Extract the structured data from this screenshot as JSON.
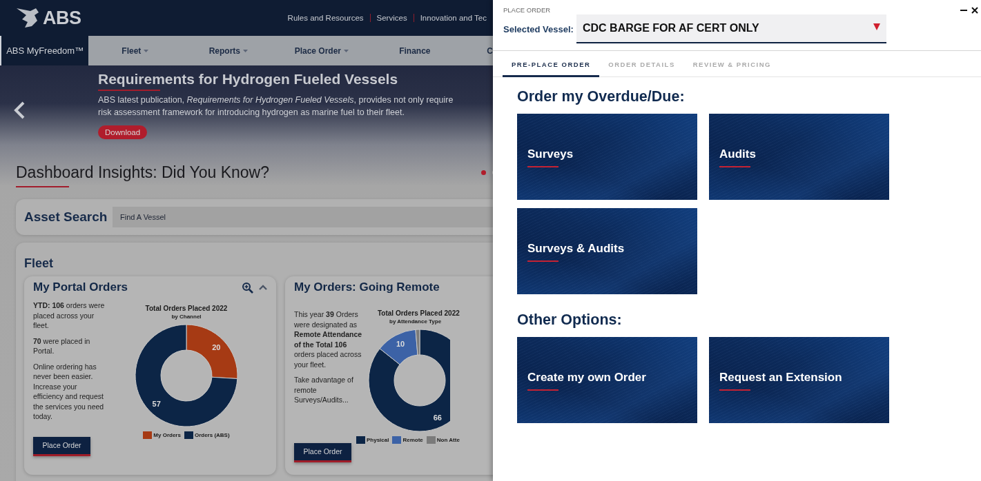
{
  "header": {
    "logo": "ABS",
    "links": [
      "Rules and Resources",
      "Services",
      "Innovation and Tec"
    ]
  },
  "nav": {
    "brand": "ABS MyFreedom™",
    "items": [
      {
        "label": "Fleet",
        "dropdown": true
      },
      {
        "label": "Reports",
        "dropdown": true
      },
      {
        "label": "Place Order",
        "dropdown": true
      },
      {
        "label": "Finance",
        "dropdown": false
      },
      {
        "label": "C",
        "dropdown": false
      }
    ]
  },
  "hero": {
    "title": "Requirements for Hydrogen Fueled Vessels",
    "lines": [
      "ABS latest publication, *Requirements for Hydrogen Fueled Vessels*, provides not only require",
      "risk assessment framework for introducing hydrogen as marine fuel to their fleet."
    ],
    "button": "Download"
  },
  "insights": {
    "title": "Dashboard Insights: Did You Know?",
    "dots": [
      {
        "selected": true
      },
      {
        "selected": false
      }
    ]
  },
  "asset_search": {
    "title": "Asset Search",
    "placeholder": "Find A Vessel"
  },
  "fleet": {
    "title": "Fleet",
    "cards": [
      {
        "title": "My Portal Orders",
        "controls": true,
        "paragraphs": [
          "**YTD: 106** orders were placed across your fleet.",
          "**70** were placed in Portal.",
          "Online ordering has never been easier. Increase your efficiency and request the services you need today."
        ],
        "button": "Place Order",
        "chart_subtitle": "by Channel",
        "chart_data": {
          "type": "donut",
          "title": "Total Orders Placed 2022",
          "categories": [
            "My Orders",
            "Orders (ABS)"
          ],
          "values": [
            20,
            57
          ],
          "colors": [
            "#a63a14",
            "#0c2546"
          ],
          "legend": "bottom",
          "data_labels": true
        }
      },
      {
        "title": "My Orders: Going Remote",
        "controls": false,
        "paragraphs": [
          "This year **39** Orders were designated as **Remote Attendance of the Total 106** orders placed across your fleet.",
          "Take advantage of remote Surveys/Audits..."
        ],
        "button": "Place Order",
        "chart_subtitle": "by Attendance Type",
        "chart_data": {
          "type": "donut",
          "title": "Total Orders Placed 2022",
          "categories": [
            "Physical",
            "Remote",
            "Non Atte"
          ],
          "values": [
            66,
            10,
            1
          ],
          "colors": [
            "#0c2546",
            "#3c62a6",
            "#7b7b7b"
          ],
          "legend": "bottom",
          "value_labels": [
            "66",
            "10",
            null
          ]
        }
      }
    ]
  },
  "panel": {
    "title": "PLACE ORDER",
    "vessel_label": "Selected Vessel:",
    "vessel": "CDC BARGE FOR AF CERT ONLY",
    "tabs": [
      {
        "label": "PRE-PLACE ORDER",
        "selected": true
      },
      {
        "label": "ORDER DETAILS",
        "selected": false
      },
      {
        "label": "REVIEW & PRICING",
        "selected": false
      }
    ],
    "sections": [
      {
        "heading": "Order my Overdue/Due:",
        "tiles": [
          "Surveys",
          "Audits",
          "Surveys & Audits"
        ]
      },
      {
        "heading": "Other Options:",
        "tiles": [
          "Create my own Order",
          "Request an Extension"
        ]
      }
    ]
  }
}
